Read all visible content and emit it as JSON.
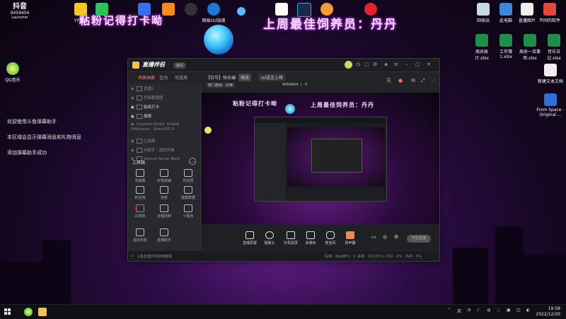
{
  "overlay": {
    "left_text": "粘粉记得打卡呦",
    "right_text": "上周最佳饲养员：丹丹"
  },
  "desktop_left": {
    "launcher_top": "抖音",
    "launcher_id": "9459404",
    "launcher_label": "Launcher",
    "qq_label": "QQ音乐",
    "msg1": "欢迎使用斗鱼弹幕助手",
    "msg2": "本区域会显示弹幕消息和礼物消息",
    "msg3": "添加弹幕助手成功"
  },
  "desktop_top_icons": [
    "YY语音",
    "",
    "",
    "",
    "",
    "网易UU加速",
    "",
    "",
    "",
    "",
    ""
  ],
  "desktop_right_icons": {
    "row1": [
      "回收站",
      "此电脑",
      "直播图片",
      "不同的软件"
    ],
    "row2": [
      "周总账计.xlsx",
      "工作簿1.xlsx",
      "周总一流事项.xlsx",
      "音乐日记.xlsx"
    ],
    "row3": [
      "新建文本文档"
    ],
    "row4": [
      "From Space - Original ..."
    ]
  },
  "app": {
    "name": "直播伴侣",
    "version": "抢先",
    "tabs": [
      "场景画面",
      "互动",
      "可选项"
    ],
    "sources": [
      {
        "label": "直播1"
      },
      {
        "label": "页面截图图"
      },
      {
        "label": "贴纸打卡"
      },
      {
        "label": "周榜"
      },
      {
        "label": "Counter-Strike: Global Offensive - Direct3D 9"
      },
      {
        "label": "已选择"
      },
      {
        "label": "AI助手 - 虚拟形象"
      },
      {
        "label": "Source Sonar Back"
      }
    ],
    "tools_title": "工具箱",
    "tools": [
      "发弹幕",
      "好物讲解",
      "粉丝团",
      "粉丝榜",
      "连麦",
      "健康数据",
      "礼物单",
      "远程控制",
      "小程序",
      "虚拟形象",
      "直播助手"
    ],
    "preview_header": {
      "title": "【仅号】快乐编",
      "tag": "修改",
      "category": "lol语言上榜",
      "mode": "热门游戏 · 大神",
      "room": "9459404",
      "count": "0"
    },
    "bottom_buttons": [
      "直播屏幕",
      "摄像头",
      "手机投屏",
      "多媒体",
      "麦克风",
      "扬声器"
    ],
    "start_live": "开始直播",
    "status_left": "斗鱼直播伴侣使用教程",
    "status_right": [
      "码率：0kb/s",
      "FPS：0",
      "丢帧：0(0.00%)",
      "CPU：0%",
      "内存：0%"
    ]
  },
  "taskbar": {
    "time": "19:58",
    "date": "2022/12/30",
    "tray_text": "英"
  }
}
